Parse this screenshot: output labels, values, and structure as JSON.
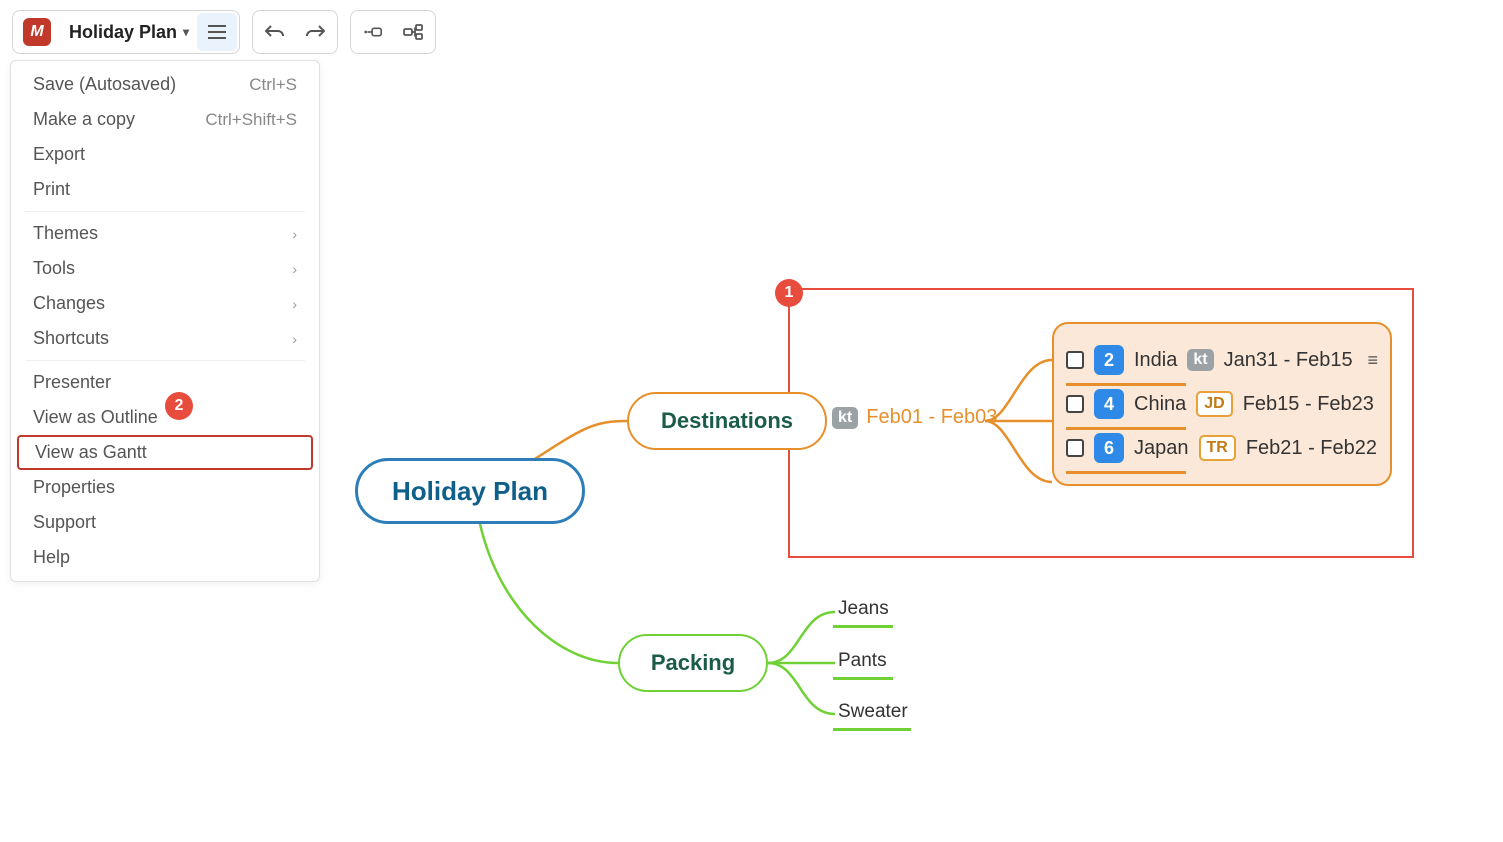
{
  "toolbar": {
    "document_title": "Holiday Plan"
  },
  "menu": {
    "items": [
      {
        "label": "Save (Autosaved)",
        "shortcut": "Ctrl+S"
      },
      {
        "label": "Make a copy",
        "shortcut": "Ctrl+Shift+S"
      },
      {
        "label": "Export"
      },
      {
        "label": "Print"
      },
      {
        "label": "Themes",
        "submenu": true
      },
      {
        "label": "Tools",
        "submenu": true
      },
      {
        "label": "Changes",
        "submenu": true
      },
      {
        "label": "Shortcuts",
        "submenu": true
      },
      {
        "label": "Presenter"
      },
      {
        "label": "View as Outline"
      },
      {
        "label": "View as Gantt"
      },
      {
        "label": "Properties"
      },
      {
        "label": "Support"
      },
      {
        "label": "Help"
      }
    ]
  },
  "annotations": {
    "marker1": "1",
    "marker2": "2"
  },
  "mindmap": {
    "root": {
      "label": "Holiday Plan"
    },
    "branches": [
      {
        "label": "Destinations",
        "assignee": "kt",
        "date_range": "Feb01 - Feb03",
        "children": [
          {
            "num": "2",
            "name": "India",
            "assignee": "kt",
            "assignee_style": "kt",
            "range": "Jan31 - Feb15",
            "menu": true
          },
          {
            "num": "4",
            "name": "China",
            "assignee": "JD",
            "assignee_style": "jd",
            "range": "Feb15 - Feb23"
          },
          {
            "num": "6",
            "name": "Japan",
            "assignee": "TR",
            "assignee_style": "tr",
            "range": "Feb21 - Feb22"
          }
        ]
      },
      {
        "label": "Packing",
        "children": [
          {
            "name": "Jeans"
          },
          {
            "name": "Pants"
          },
          {
            "name": "Sweater"
          }
        ]
      }
    ]
  }
}
